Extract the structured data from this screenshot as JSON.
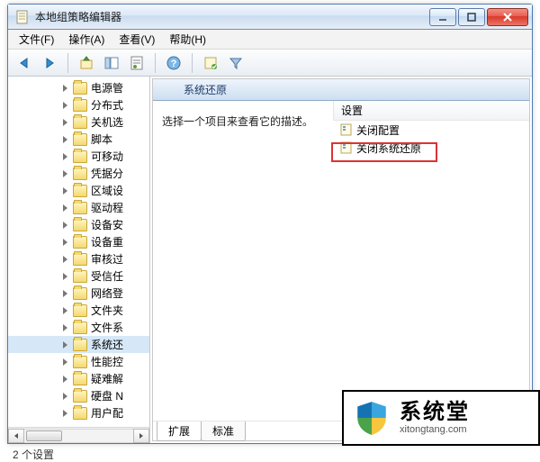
{
  "window": {
    "title": "本地组策略编辑器"
  },
  "menubar": {
    "file": {
      "label": "文件",
      "accel": "(F)"
    },
    "action": {
      "label": "操作",
      "accel": "(A)"
    },
    "view": {
      "label": "查看",
      "accel": "(V)"
    },
    "help": {
      "label": "帮助",
      "accel": "(H)"
    }
  },
  "tree": {
    "items": [
      "电源管",
      "分布式",
      "关机选",
      "脚本",
      "可移动",
      "凭据分",
      "区域设",
      "驱动程",
      "设备安",
      "设备重",
      "审核过",
      "受信任",
      "网络登",
      "文件夹",
      "文件系",
      "系统还",
      "性能控",
      "疑难解",
      "硬盘 N",
      "用户配"
    ],
    "selected_index": 15
  },
  "right": {
    "title": "系统还原",
    "description": "选择一个项目来查看它的描述。",
    "settings_header": "设置",
    "settings": [
      {
        "label": "关闭配置"
      },
      {
        "label": "关闭系统还原"
      }
    ],
    "highlight_index": 1
  },
  "tabs": {
    "extended": "扩展",
    "standard": "标准",
    "active": 0
  },
  "status": "2 个设置",
  "watermark": {
    "line1": "系统堂",
    "line2": "xitongtang.com"
  }
}
